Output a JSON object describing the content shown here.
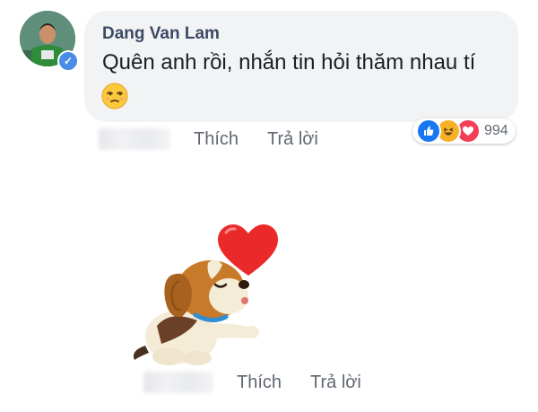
{
  "comment1": {
    "author": "Dang Van Lam",
    "text": "Quên anh rồi, nhắn tin hỏi thăm nhau tí",
    "emoji": "unamused-face",
    "actions": {
      "like": "Thích",
      "reply": "Trả lời"
    },
    "reactions": {
      "types": [
        "like",
        "haha",
        "love"
      ],
      "count": "994"
    }
  },
  "comment2": {
    "sticker": "puppy-blowing-heart",
    "actions": {
      "like": "Thích",
      "reply": "Trả lời"
    }
  },
  "colors": {
    "bubble": "#f2f3f5",
    "author": "#3b4a63",
    "action": "#606770",
    "like": "#1877f2",
    "love": "#f33e58",
    "haha": "#f7b125",
    "verified": "#4a8de8"
  }
}
